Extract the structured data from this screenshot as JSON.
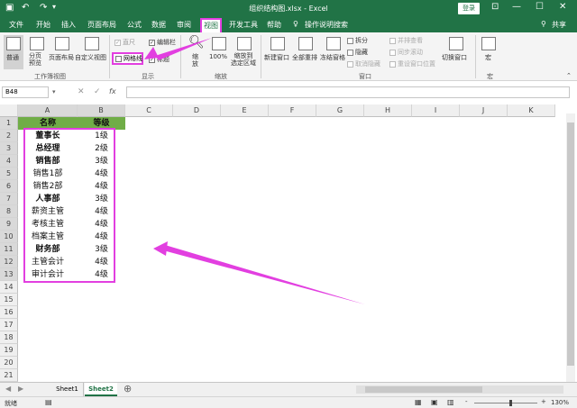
{
  "titlebar": {
    "title": "组织结构图.xlsx - Excel",
    "login_label": "登录",
    "save_icon": "save-icon",
    "minimize": "—",
    "restore": "☐",
    "close": "✕"
  },
  "tabs": [
    "文件",
    "开始",
    "插入",
    "页面布局",
    "公式",
    "数据",
    "审阅",
    "视图",
    "开发工具",
    "帮助"
  ],
  "tell_me": "操作说明搜索",
  "share_label": "共享",
  "ribbon": {
    "views": {
      "normal": "普通",
      "page_break": "分页\n预览",
      "page_layout": "页面布局",
      "custom": "自定义视图",
      "label": "工作簿视图"
    },
    "show": {
      "ruler": "直尺",
      "formula_bar": "编辑栏",
      "gridlines": "网格线",
      "headings": "标题",
      "label": "显示"
    },
    "zoom": {
      "zoom": "缩\n放",
      "hundred": "100%",
      "to_selection": "缩放到\n选定区域",
      "label": "缩放"
    },
    "window": {
      "new_window": "新建窗口",
      "arrange_all": "全部重排",
      "freeze": "冻结窗格",
      "split": "拆分",
      "hide": "隐藏",
      "unhide": "取消隐藏",
      "side_by_side": "并排查看",
      "sync_scroll": "同步滚动",
      "reset_pos": "重设窗口位置",
      "switch": "切换窗口",
      "label": "窗口"
    },
    "macros": {
      "macros": "宏",
      "label": "宏"
    }
  },
  "namebox": "B48",
  "fx": "fx",
  "columns": [
    "A",
    "B",
    "C",
    "D",
    "E",
    "F",
    "G",
    "H",
    "I",
    "J",
    "K"
  ],
  "rows": [
    "1",
    "2",
    "3",
    "4",
    "5",
    "6",
    "7",
    "8",
    "9",
    "10",
    "11",
    "12",
    "13",
    "14",
    "15",
    "16",
    "17",
    "18",
    "19",
    "20",
    "21"
  ],
  "table": {
    "headers": [
      "名称",
      "等级"
    ],
    "rows": [
      {
        "name": "董事长",
        "level": "1级",
        "bold": true
      },
      {
        "name": "总经理",
        "level": "2级",
        "bold": true
      },
      {
        "name": "销售部",
        "level": "3级",
        "bold": true
      },
      {
        "name": "销售1部",
        "level": "4级",
        "bold": false
      },
      {
        "name": "销售2部",
        "level": "4级",
        "bold": false
      },
      {
        "name": "人事部",
        "level": "3级",
        "bold": true
      },
      {
        "name": "薪资主管",
        "level": "4级",
        "bold": false
      },
      {
        "name": "考核主管",
        "level": "4级",
        "bold": false
      },
      {
        "name": "档案主管",
        "level": "4级",
        "bold": false
      },
      {
        "name": "财务部",
        "level": "3级",
        "bold": true
      },
      {
        "name": "主管会计",
        "level": "4级",
        "bold": false
      },
      {
        "name": "审计会计",
        "level": "4级",
        "bold": false
      }
    ]
  },
  "sheets": [
    "Sheet1",
    "Sheet2"
  ],
  "status": {
    "ready": "就绪",
    "zoom": "130%",
    "minus": "-",
    "plus": "+"
  },
  "colors": {
    "excel_green": "#217346",
    "header_fill": "#70ad47",
    "highlight": "#e23fe0"
  }
}
